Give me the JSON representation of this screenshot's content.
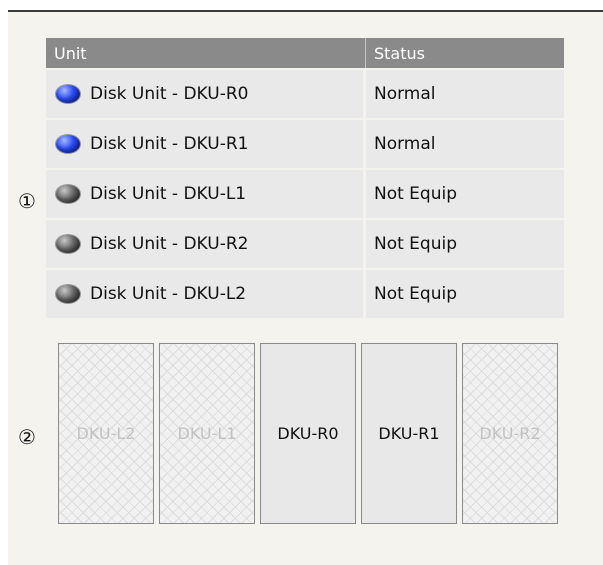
{
  "table": {
    "headers": {
      "unit": "Unit",
      "status": "Status"
    },
    "rows": [
      {
        "unit": "Disk Unit - DKU-R0",
        "status": "Normal",
        "indicator": "blue-led-icon"
      },
      {
        "unit": "Disk Unit - DKU-R1",
        "status": "Normal",
        "indicator": "blue-led-icon"
      },
      {
        "unit": "Disk Unit - DKU-L1",
        "status": "Not Equip",
        "indicator": "gray-led-icon"
      },
      {
        "unit": "Disk Unit - DKU-R2",
        "status": "Not Equip",
        "indicator": "gray-led-icon"
      },
      {
        "unit": "Disk Unit - DKU-L2",
        "status": "Not Equip",
        "indicator": "gray-led-icon"
      }
    ]
  },
  "markers": {
    "one": "①",
    "two": "②"
  },
  "bays": [
    {
      "label": "DKU-L2",
      "state": "empty"
    },
    {
      "label": "DKU-L1",
      "state": "empty"
    },
    {
      "label": "DKU-R0",
      "state": "present"
    },
    {
      "label": "DKU-R1",
      "state": "present"
    },
    {
      "label": "DKU-R2",
      "state": "empty"
    }
  ],
  "colors": {
    "header_bg": "#8a8a8a",
    "row_bg": "#e9e9e9",
    "led_normal": "#2a4df5",
    "led_not_equip": "#555555"
  }
}
